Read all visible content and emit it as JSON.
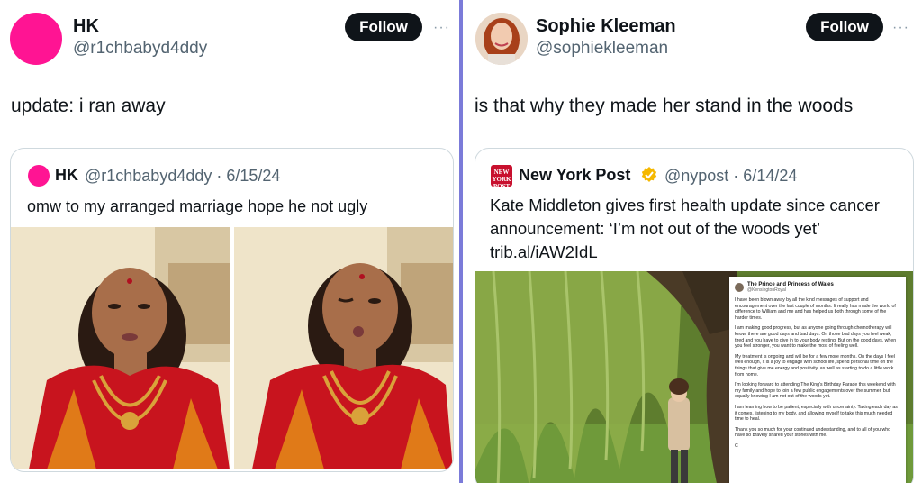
{
  "left": {
    "author": {
      "name": "HK",
      "handle": "@r1chbabyd4ddy"
    },
    "follow_label": "Follow",
    "more": "···",
    "text": "update: i ran away",
    "quote": {
      "name": "HK",
      "meta": "@r1chbabyd4ddy · 6/15/24",
      "text": "omw to my arranged marriage hope he not ugly"
    }
  },
  "right": {
    "author": {
      "name": "Sophie Kleeman",
      "handle": "@sophiekleeman"
    },
    "follow_label": "Follow",
    "more": "···",
    "text": "is that why they made her stand in the woods",
    "quote": {
      "logo_text": "NEW YORK POST",
      "name": "New York Post",
      "meta": "@nypost · 6/14/24",
      "text": "Kate Middleton gives first health update since cancer announcement: ‘I’m not out of the woods yet’ trib.al/iAW2IdL",
      "statement": {
        "name": "The Prince and Princess of Wales",
        "handle": "@KensingtonRoyal",
        "paragraphs": [
          "I have been blown away by all the kind messages of support and encouragement over the last couple of months. It really has made the world of difference to William and me and has helped us both through some of the harder times.",
          "I am making good progress, but as anyone going through chemotherapy will know, there are good days and bad days. On those bad days you feel weak, tired and you have to give in to your body resting. But on the good days, when you feel stronger, you want to make the most of feeling well.",
          "My treatment is ongoing and will be for a few more months. On the days I feel well enough, it is a joy to engage with school life, spend personal time on the things that give me energy and positivity, as well as starting to do a little work from home.",
          "I'm looking forward to attending The King's Birthday Parade this weekend with my family and hope to join a few public engagements over the summer, but equally knowing I am not out of the woods yet.",
          "I am learning how to be patient, especially with uncertainty. Taking each day as it comes, listening to my body, and allowing myself to take this much needed time to heal.",
          "Thank you so much for your continued understanding, and to all of you who have so bravely shared your stories with me.",
          "C"
        ]
      }
    }
  },
  "colors": {
    "divider": "#7b7bd9",
    "accent_pink": "#ff1493",
    "follow_bg": "#0f1419",
    "nyp_red": "#c8102e",
    "verified": "#f5b800"
  }
}
